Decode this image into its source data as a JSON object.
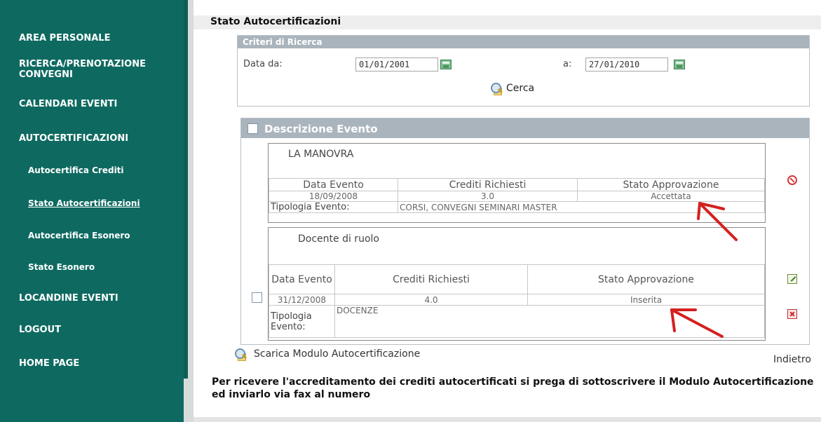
{
  "sidebar": {
    "items": [
      {
        "label": "AREA PERSONALE"
      },
      {
        "label": "RICERCA/PRENOTAZIONE CONVEGNI"
      },
      {
        "label": "CALENDARI EVENTI"
      },
      {
        "label": "AUTOCERTIFICAZIONI"
      },
      {
        "label": "Autocertifica Crediti"
      },
      {
        "label": "Stato Autocertificazioni"
      },
      {
        "label": "Autocertifica Esonero"
      },
      {
        "label": "Stato Esonero"
      },
      {
        "label": "LOCANDINE EVENTI"
      },
      {
        "label": "LOGOUT"
      },
      {
        "label": "HOME PAGE"
      }
    ]
  },
  "page": {
    "title": "Stato Autocertificazioni"
  },
  "search": {
    "header": "Criteri di Ricerca",
    "date_from_label": "Data da:",
    "date_from_value": "01/01/2001",
    "date_to_label": "a:",
    "date_to_value": "27/01/2010",
    "search_label": "Cerca"
  },
  "results": {
    "header": "Descrizione Evento",
    "events": [
      {
        "title": "LA MANOVRA",
        "col_date": "Data Evento",
        "col_credits": "Crediti Richiesti",
        "col_status": "Stato Approvazione",
        "date": "18/09/2008",
        "credits": "3.0",
        "status": "Accettata",
        "type_label": "Tipologia Evento:",
        "type_value": "CORSI, CONVEGNI SEMINARI MASTER"
      },
      {
        "title": "Docente di ruolo",
        "col_date": "Data Evento",
        "col_credits": "Crediti Richiesti",
        "col_status": "Stato Approvazione",
        "date": "31/12/2008",
        "credits": "4.0",
        "status": "Inserita",
        "type_label": "Tipologia Evento:",
        "type_value": "DOCENZE"
      }
    ]
  },
  "footer": {
    "download_label": "Scarica Modulo Autocertificazione",
    "back_label": "Indietro",
    "notice": "Per ricevere l'accreditamento dei crediti autocertificati si prega di sottoscrivere il Modulo Autocertificazione ed inviarlo via fax al numero"
  },
  "colors": {
    "sidebar": "#0e6a61",
    "header_gray": "#aab4bc",
    "annotation_red": "#d42020"
  },
  "icons": [
    "calendar-icon",
    "search-icon",
    "cancel-icon",
    "edit-icon",
    "delete-icon",
    "arrow-annotation"
  ]
}
